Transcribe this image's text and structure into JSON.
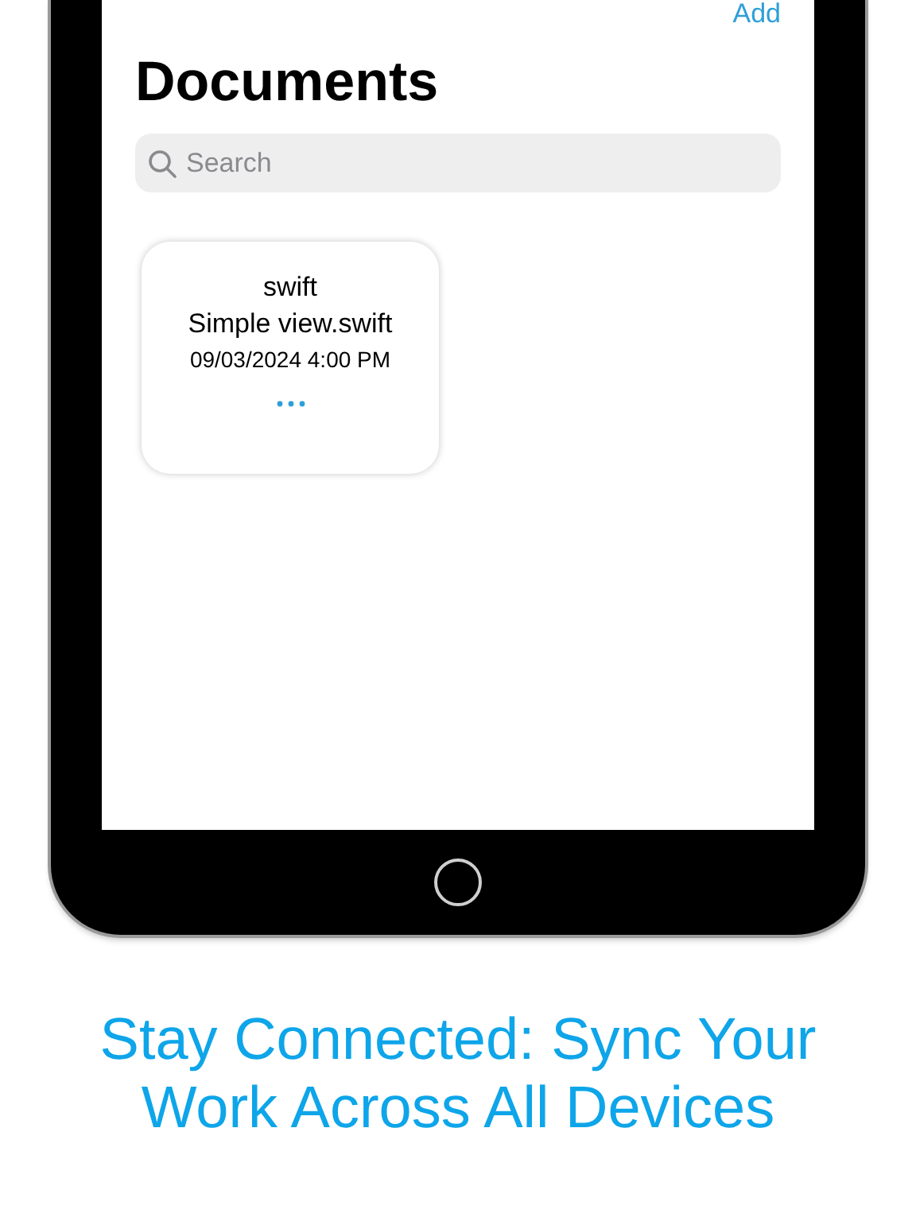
{
  "screen": {
    "add_button": "Add",
    "title": "Documents",
    "search": {
      "placeholder": "Search"
    },
    "documents": [
      {
        "type": "swift",
        "name": "Simple view.swift",
        "date": "09/03/2024 4:00 PM"
      }
    ]
  },
  "caption": "Stay Connected: Sync Your Work Across All Devices"
}
